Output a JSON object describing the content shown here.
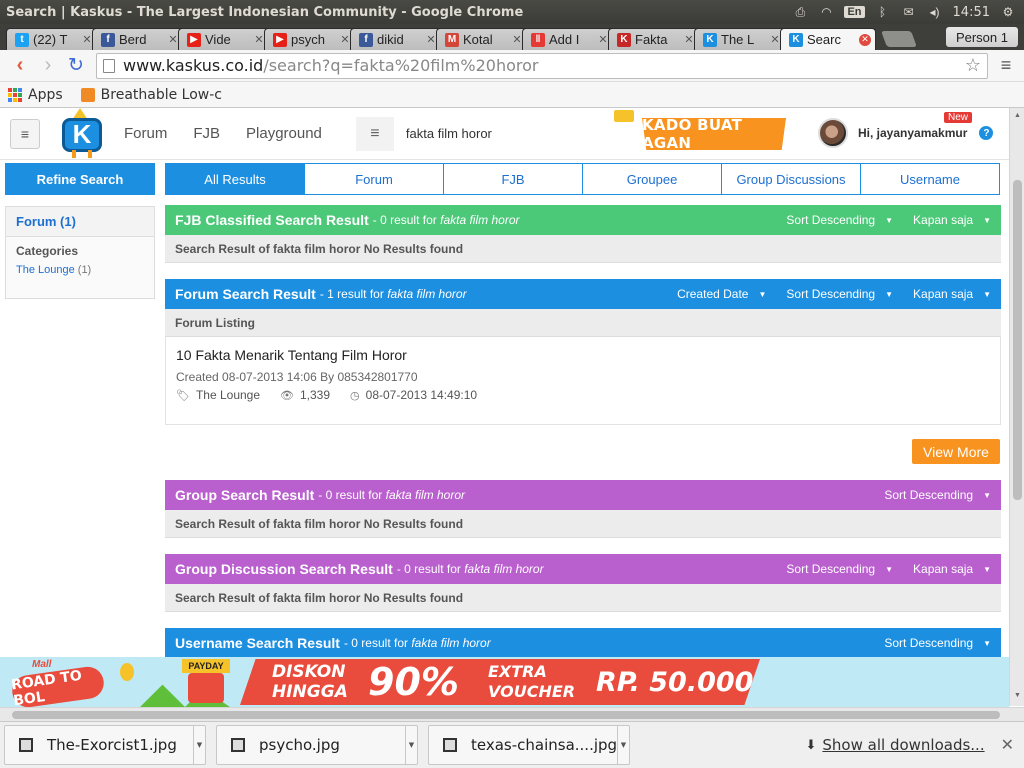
{
  "os": {
    "window_title": "Search | Kaskus - The Largest Indonesian Community - Google Chrome",
    "lang": "En",
    "time": "14:51"
  },
  "tabs": [
    {
      "title": "(22) T",
      "favicon": "twitter-icon",
      "color": "#1da1f2",
      "glyph": "t"
    },
    {
      "title": "Berd",
      "favicon": "facebook-icon",
      "color": "#3b5998",
      "glyph": "f"
    },
    {
      "title": "Vide",
      "favicon": "youtube-icon",
      "color": "#e62117",
      "glyph": "▶"
    },
    {
      "title": "psych",
      "favicon": "youtube-icon",
      "color": "#e62117",
      "glyph": "▶"
    },
    {
      "title": "dikid",
      "favicon": "facebook-icon",
      "color": "#3b5998",
      "glyph": "f"
    },
    {
      "title": "Kotal",
      "favicon": "gmail-icon",
      "color": "#d44638",
      "glyph": "M"
    },
    {
      "title": "Add I",
      "favicon": "pause-icon",
      "color": "#e53935",
      "glyph": "‖"
    },
    {
      "title": "Fakta",
      "favicon": "ks-icon",
      "color": "#c62828",
      "glyph": "K"
    },
    {
      "title": "The L",
      "favicon": "kaskus-icon",
      "color": "#1d8fe0",
      "glyph": "K"
    },
    {
      "title": "Searc",
      "favicon": "kaskus-icon",
      "color": "#1d8fe0",
      "glyph": "K",
      "active": true
    }
  ],
  "profile_button": "Person 1",
  "address": {
    "host": "www.kaskus.co.id",
    "path": "/search?q=fakta%20film%20horor"
  },
  "bookmarks": {
    "apps": "Apps",
    "item1": "Breathable Low-c"
  },
  "header": {
    "nav": [
      "Forum",
      "FJB",
      "Playground"
    ],
    "search_value": "fakta film horor",
    "promo": "KADO BUAT AGAN",
    "greeting": "Hi, jayanyamakmur",
    "new_badge": "New"
  },
  "sidebar": {
    "refine": "Refine Search",
    "forum_filter": "Forum (1)",
    "categories_title": "Categories",
    "category_name": "The Lounge",
    "category_count": "(1)"
  },
  "result_tabs": [
    "All Results",
    "Forum",
    "FJB",
    "Groupee",
    "Group Discussions",
    "Username"
  ],
  "query": "fakta film horor",
  "sections": {
    "fjb": {
      "title": "FJB Classified Search Result",
      "count_text": "- 0 result for",
      "sort": "Sort Descending",
      "time": "Kapan saja",
      "body": "Search Result of fakta film horor No Results found"
    },
    "forum": {
      "title": "Forum Search Result",
      "count_text": "- 1 result for",
      "date_filter": "Created Date",
      "sort": "Sort Descending",
      "time": "Kapan saja",
      "listing_label": "Forum Listing",
      "item": {
        "title": "10 Fakta Menarik Tentang Film Horor",
        "created": "Created 08-07-2013 14:06 By 085342801770",
        "category": "The Lounge",
        "views": "1,339",
        "last_post": "08-07-2013 14:49:10"
      },
      "view_more": "View More"
    },
    "group": {
      "title": "Group Search Result",
      "count_text": "- 0 result for",
      "sort": "Sort Descending",
      "body": "Search Result of fakta film horor No Results found"
    },
    "group_discussion": {
      "title": "Group Discussion Search Result",
      "count_text": "- 0 result for",
      "sort": "Sort Descending",
      "time": "Kapan saja",
      "body": "Search Result of fakta film horor No Results found"
    },
    "username": {
      "title": "Username Search Result",
      "count_text": "- 0 result for",
      "sort": "Sort Descending"
    }
  },
  "ad": {
    "mall": "Mall",
    "road": "ROAD TO BOL",
    "payday": "PAYDAY",
    "diskon": "DISKON",
    "hingga": "HINGGA",
    "percent": "90%",
    "extra": "EXTRA",
    "voucher": "VOUCHER",
    "amount": "RP. 50.000"
  },
  "downloads": {
    "files": [
      "The-Exorcist1.jpg",
      "psycho.jpg",
      "texas-chainsa....jpg"
    ],
    "show_all": "Show all downloads..."
  }
}
